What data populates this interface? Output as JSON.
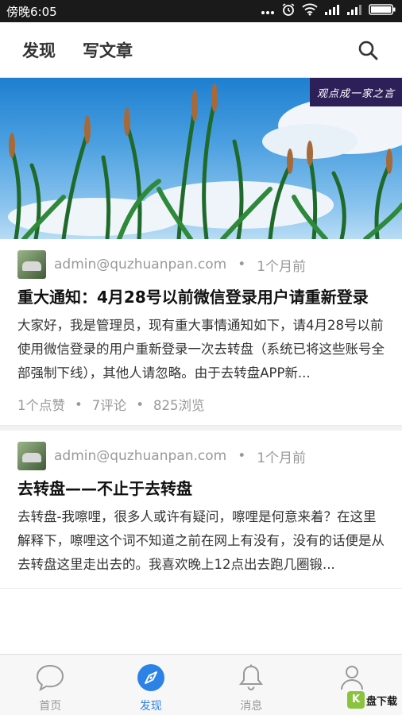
{
  "status_bar": {
    "time": "傍晚6:05"
  },
  "header": {
    "tabs": [
      {
        "label": "发现"
      },
      {
        "label": "写文章"
      }
    ]
  },
  "banner": {
    "tag": "观点成一家之言"
  },
  "posts": [
    {
      "author": "admin@quzhuanpan.com",
      "time": "1个月前",
      "title": "重大通知：4月28号以前微信登录用户请重新登录",
      "excerpt": "大家好，我是管理员，现有重大事情通知如下，请4月28号以前使用微信登录的用户重新登录一次去转盘（系统已将这些账号全部强制下线），其他人请忽略。由于去转盘APP新...",
      "likes": "1个点赞",
      "comments": "7评论",
      "views": "825浏览"
    },
    {
      "author": "admin@quzhuanpan.com",
      "time": "1个月前",
      "title": "去转盘——不止于去转盘",
      "excerpt": "去转盘-我嚓哩，很多人或许有疑问，嚓哩是何意来着？在这里解释下，嚓哩这个词不知道之前在网上有没有，没有的话便是从去转盘这里走出去的。我喜欢晚上12点出去跑几圈锻..."
    }
  ],
  "tabbar": {
    "items": [
      {
        "label": "首页",
        "icon": "chat-bubble-icon"
      },
      {
        "label": "发现",
        "icon": "compass-icon"
      },
      {
        "label": "消息",
        "icon": "bell-icon"
      },
      {
        "label": "",
        "icon": "person-icon"
      }
    ],
    "active_color": "#2d82e6"
  },
  "watermark": {
    "letter": "K",
    "text": "盘下载"
  },
  "colors": {
    "accent": "#2d82e6",
    "status_bar_bg": "#1a1a1a"
  }
}
